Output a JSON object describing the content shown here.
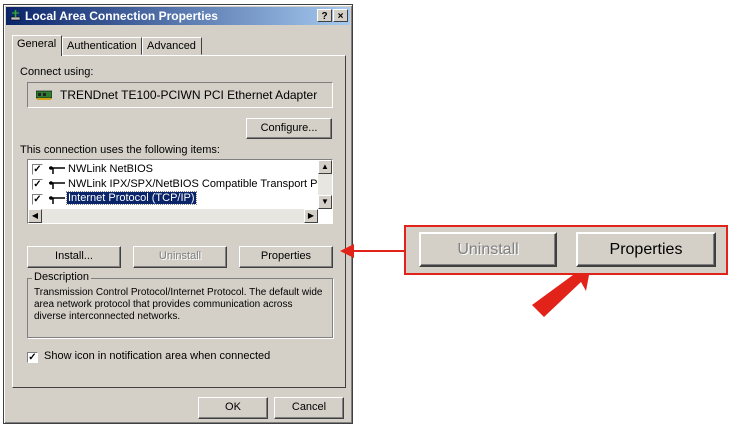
{
  "window": {
    "title": "Local Area Connection Properties",
    "help_button": "?",
    "close_button": "×"
  },
  "tabs": [
    "General",
    "Authentication",
    "Advanced"
  ],
  "connect_using_label": "Connect using:",
  "adapter_name": "TRENDnet TE100-PCIWN PCI Ethernet Adapter",
  "configure_button": "Configure...",
  "items_label": "This connection uses the following items:",
  "items": [
    {
      "label": "NWLink NetBIOS",
      "checked": true,
      "selected": false
    },
    {
      "label": "NWLink IPX/SPX/NetBIOS Compatible Transport Proto",
      "checked": true,
      "selected": false
    },
    {
      "label": "Internet Protocol (TCP/IP)",
      "checked": true,
      "selected": true
    }
  ],
  "buttons": {
    "install": "Install...",
    "uninstall": "Uninstall",
    "properties": "Properties",
    "ok": "OK",
    "cancel": "Cancel"
  },
  "description": {
    "title": "Description",
    "text": "Transmission Control Protocol/Internet Protocol. The default wide area network protocol that provides communication across diverse interconnected networks."
  },
  "show_icon_label": "Show icon in notification area when connected",
  "show_icon_checked": true,
  "zoom": {
    "uninstall": "Uninstall",
    "properties": "Properties"
  },
  "colors": {
    "callout": "#e2231a",
    "title_bar": "#0a246a",
    "selection": "#0a246a"
  }
}
